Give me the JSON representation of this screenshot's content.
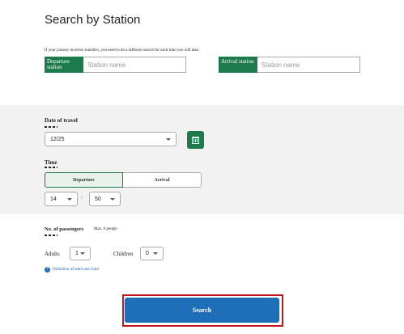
{
  "page": {
    "title": "Search by Station",
    "note": "If your journey involves transfers, you need to do a different search for each train you will take."
  },
  "departure": {
    "label": "Departure station",
    "placeholder": "Station name"
  },
  "arrival": {
    "label": "Arrival station",
    "placeholder": "Station name"
  },
  "date": {
    "heading": "Date of travel",
    "value": "12/25"
  },
  "time": {
    "heading": "Time",
    "departure_label": "Departure",
    "arrival_label": "Arrival",
    "hour": "14",
    "separator": ":",
    "minute": "50"
  },
  "passengers": {
    "heading": "No. of passengers",
    "max_note": "Max. 6 people",
    "adults_label": "Adults",
    "adults_value": "1",
    "children_label": "Children",
    "children_value": "0",
    "definition_link": "Definition of adult and child"
  },
  "search": {
    "label": "Search"
  },
  "colors": {
    "green": "#1d7a4a",
    "blue": "#1f6fb8",
    "highlight_red": "#c4161c",
    "panel_grey": "#f2f2f2"
  }
}
